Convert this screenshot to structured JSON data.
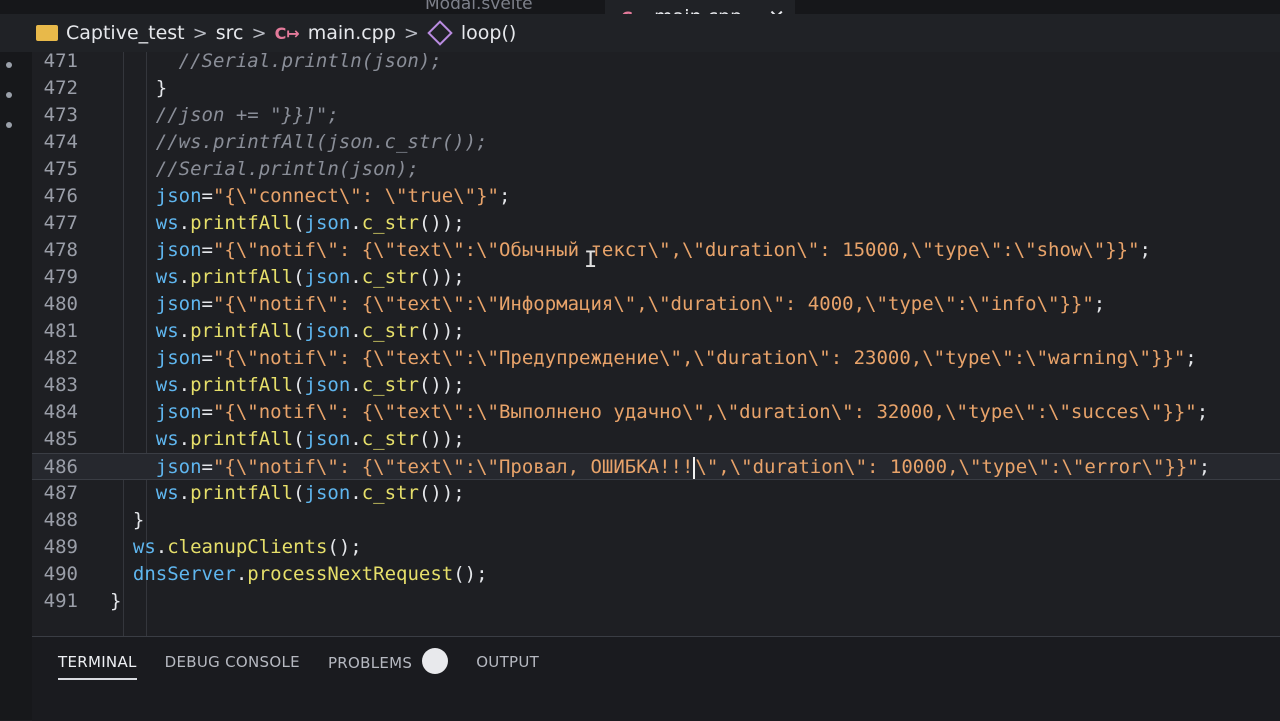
{
  "tabs": {
    "inactive_label": "Modal.svelte",
    "active_label": "main.cpp",
    "file_badge": "C↦",
    "close_glyph": "✕"
  },
  "breadcrumb": {
    "project": "Captive_test",
    "folder": "src",
    "file": "main.cpp",
    "symbol": "loop()",
    "separator": ">"
  },
  "editor": {
    "lines": [
      {
        "n": "471",
        "indent": "      ",
        "parts": [
          {
            "t": "//Serial.println(json);",
            "c": "cm"
          }
        ]
      },
      {
        "n": "472",
        "indent": "    ",
        "parts": [
          {
            "t": "}",
            "c": "pun"
          }
        ]
      },
      {
        "n": "473",
        "indent": "    ",
        "parts": [
          {
            "t": "//json += \"}}]\";",
            "c": "cm"
          }
        ]
      },
      {
        "n": "474",
        "indent": "    ",
        "parts": [
          {
            "t": "//ws.printfAll(json.c_str());",
            "c": "cm"
          }
        ]
      },
      {
        "n": "475",
        "indent": "    ",
        "parts": [
          {
            "t": "//Serial.println(json);",
            "c": "cm"
          }
        ]
      },
      {
        "n": "476",
        "indent": "    ",
        "parts": [
          {
            "t": "json",
            "c": "var"
          },
          {
            "t": "=",
            "c": "pun"
          },
          {
            "t": "\"{\\\"connect\\\": \\\"true\\\"}\"",
            "c": "str"
          },
          {
            "t": ";",
            "c": "pun"
          }
        ]
      },
      {
        "n": "477",
        "indent": "    ",
        "parts": [
          {
            "t": "ws",
            "c": "var"
          },
          {
            "t": ".",
            "c": "pun"
          },
          {
            "t": "printfAll",
            "c": "fn"
          },
          {
            "t": "(",
            "c": "pun"
          },
          {
            "t": "json",
            "c": "var"
          },
          {
            "t": ".",
            "c": "pun"
          },
          {
            "t": "c_str",
            "c": "fn"
          },
          {
            "t": "());",
            "c": "pun"
          }
        ]
      },
      {
        "n": "478",
        "indent": "    ",
        "parts": [
          {
            "t": "json",
            "c": "var"
          },
          {
            "t": "=",
            "c": "pun"
          },
          {
            "t": "\"{\\\"notif\\\": {\\\"text\\\":\\\"Обычный текст\\\",\\\"duration\\\": 15000,\\\"type\\\":\\\"show\\\"}}\"",
            "c": "str"
          },
          {
            "t": ";",
            "c": "pun"
          }
        ]
      },
      {
        "n": "479",
        "indent": "    ",
        "parts": [
          {
            "t": "ws",
            "c": "var"
          },
          {
            "t": ".",
            "c": "pun"
          },
          {
            "t": "printfAll",
            "c": "fn"
          },
          {
            "t": "(",
            "c": "pun"
          },
          {
            "t": "json",
            "c": "var"
          },
          {
            "t": ".",
            "c": "pun"
          },
          {
            "t": "c_str",
            "c": "fn"
          },
          {
            "t": "());",
            "c": "pun"
          }
        ]
      },
      {
        "n": "480",
        "indent": "    ",
        "parts": [
          {
            "t": "json",
            "c": "var"
          },
          {
            "t": "=",
            "c": "pun"
          },
          {
            "t": "\"{\\\"notif\\\": {\\\"text\\\":\\\"Информация\\\",\\\"duration\\\": 4000,\\\"type\\\":\\\"info\\\"}}\"",
            "c": "str"
          },
          {
            "t": ";",
            "c": "pun"
          }
        ]
      },
      {
        "n": "481",
        "indent": "    ",
        "parts": [
          {
            "t": "ws",
            "c": "var"
          },
          {
            "t": ".",
            "c": "pun"
          },
          {
            "t": "printfAll",
            "c": "fn"
          },
          {
            "t": "(",
            "c": "pun"
          },
          {
            "t": "json",
            "c": "var"
          },
          {
            "t": ".",
            "c": "pun"
          },
          {
            "t": "c_str",
            "c": "fn"
          },
          {
            "t": "());",
            "c": "pun"
          }
        ]
      },
      {
        "n": "482",
        "indent": "    ",
        "parts": [
          {
            "t": "json",
            "c": "var"
          },
          {
            "t": "=",
            "c": "pun"
          },
          {
            "t": "\"{\\\"notif\\\": {\\\"text\\\":\\\"Предупреждение\\\",\\\"duration\\\": 23000,\\\"type\\\":\\\"warning\\\"}}\"",
            "c": "str"
          },
          {
            "t": ";",
            "c": "pun"
          }
        ]
      },
      {
        "n": "483",
        "indent": "    ",
        "parts": [
          {
            "t": "ws",
            "c": "var"
          },
          {
            "t": ".",
            "c": "pun"
          },
          {
            "t": "printfAll",
            "c": "fn"
          },
          {
            "t": "(",
            "c": "pun"
          },
          {
            "t": "json",
            "c": "var"
          },
          {
            "t": ".",
            "c": "pun"
          },
          {
            "t": "c_str",
            "c": "fn"
          },
          {
            "t": "());",
            "c": "pun"
          }
        ]
      },
      {
        "n": "484",
        "indent": "    ",
        "parts": [
          {
            "t": "json",
            "c": "var"
          },
          {
            "t": "=",
            "c": "pun"
          },
          {
            "t": "\"{\\\"notif\\\": {\\\"text\\\":\\\"Выполнено удачно\\\",\\\"duration\\\": 32000,\\\"type\\\":\\\"succes\\\"}}\"",
            "c": "str"
          },
          {
            "t": ";",
            "c": "pun"
          }
        ]
      },
      {
        "n": "485",
        "indent": "    ",
        "parts": [
          {
            "t": "ws",
            "c": "var"
          },
          {
            "t": ".",
            "c": "pun"
          },
          {
            "t": "printfAll",
            "c": "fn"
          },
          {
            "t": "(",
            "c": "pun"
          },
          {
            "t": "json",
            "c": "var"
          },
          {
            "t": ".",
            "c": "pun"
          },
          {
            "t": "c_str",
            "c": "fn"
          },
          {
            "t": "());",
            "c": "pun"
          }
        ]
      },
      {
        "n": "486",
        "indent": "    ",
        "current": true,
        "parts": [
          {
            "t": "json",
            "c": "var"
          },
          {
            "t": "=",
            "c": "pun"
          },
          {
            "t": "\"{\\\"notif\\\": {\\\"text\\\":\\\"Провал, ОШИБКА!!!",
            "c": "str"
          },
          {
            "t": "",
            "c": "caret"
          },
          {
            "t": "\\\",\\\"duration\\\": 10000,\\\"type\\\":\\\"error\\\"}}\"",
            "c": "str"
          },
          {
            "t": ";",
            "c": "pun"
          }
        ]
      },
      {
        "n": "487",
        "indent": "    ",
        "parts": [
          {
            "t": "ws",
            "c": "var"
          },
          {
            "t": ".",
            "c": "pun"
          },
          {
            "t": "printfAll",
            "c": "fn"
          },
          {
            "t": "(",
            "c": "pun"
          },
          {
            "t": "json",
            "c": "var"
          },
          {
            "t": ".",
            "c": "pun"
          },
          {
            "t": "c_str",
            "c": "fn"
          },
          {
            "t": "());",
            "c": "pun"
          }
        ]
      },
      {
        "n": "488",
        "indent": "  ",
        "parts": [
          {
            "t": "}",
            "c": "pun"
          }
        ]
      },
      {
        "n": "489",
        "indent": "  ",
        "parts": [
          {
            "t": "ws",
            "c": "var"
          },
          {
            "t": ".",
            "c": "pun"
          },
          {
            "t": "cleanupClients",
            "c": "fn"
          },
          {
            "t": "();",
            "c": "pun"
          }
        ]
      },
      {
        "n": "490",
        "indent": "  ",
        "parts": [
          {
            "t": "dnsServer",
            "c": "var"
          },
          {
            "t": ".",
            "c": "pun"
          },
          {
            "t": "processNextRequest",
            "c": "fn"
          },
          {
            "t": "();",
            "c": "pun"
          }
        ]
      },
      {
        "n": "491",
        "indent": "",
        "parts": [
          {
            "t": "}",
            "c": "pun"
          }
        ]
      }
    ]
  },
  "panel": {
    "tabs": [
      "TERMINAL",
      "DEBUG CONSOLE",
      "PROBLEMS",
      "OUTPUT"
    ],
    "active": "TERMINAL"
  },
  "colors": {
    "background": "#1e1f23",
    "variable": "#5fb6ef",
    "function": "#e6df6a",
    "string": "#e8a36a",
    "comment": "#8a8e98",
    "folder": "#e8b94a",
    "cpp_badge": "#e37a9a"
  }
}
